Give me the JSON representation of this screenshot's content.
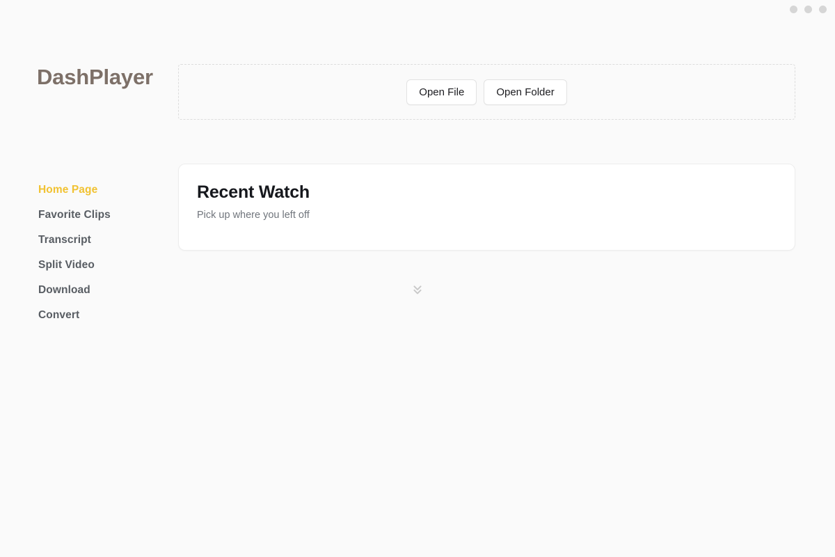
{
  "window": {
    "controls": [
      {
        "name": "minimize-dot"
      },
      {
        "name": "maximize-dot"
      },
      {
        "name": "close-dot"
      }
    ]
  },
  "brand": {
    "logo_text": "DashPlayer"
  },
  "toolbar": {
    "open_file_label": "Open File",
    "open_folder_label": "Open Folder"
  },
  "sidebar": {
    "items": [
      {
        "label": "Home Page",
        "active": true
      },
      {
        "label": "Favorite Clips",
        "active": false
      },
      {
        "label": "Transcript",
        "active": false
      },
      {
        "label": "Split Video",
        "active": false
      },
      {
        "label": "Download",
        "active": false
      },
      {
        "label": "Convert",
        "active": false
      }
    ]
  },
  "main": {
    "recent_watch": {
      "title": "Recent Watch",
      "subtitle": "Pick up where you left off"
    },
    "scroll_hint_icon": "chevrons-down-icon"
  },
  "colors": {
    "background": "#fafafa",
    "accent": "#f1c232",
    "logo": "#7d7068",
    "nav_text": "#585d63",
    "card_bg": "#ffffff",
    "card_border": "#ededed",
    "dropzone_border": "#dcdcdc",
    "window_dot": "#d6d6d6",
    "subtitle_text": "#70757c",
    "title_text": "#16181d"
  }
}
